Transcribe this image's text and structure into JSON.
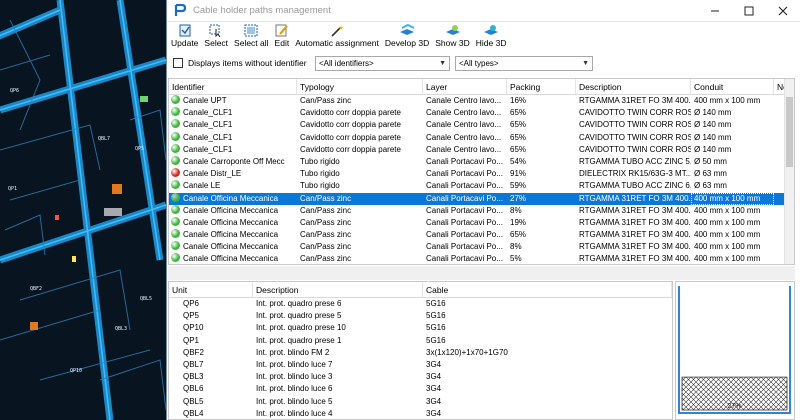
{
  "window": {
    "title": "Cable holder paths management",
    "minimize_icon": "minimize-icon",
    "maximize_icon": "maximize-icon",
    "close_icon": "close-icon"
  },
  "toolbar": {
    "items": [
      {
        "label": "Update",
        "icon": "update-icon"
      },
      {
        "label": "Select",
        "icon": "select-icon"
      },
      {
        "label": "Select all",
        "icon": "select-all-icon"
      },
      {
        "label": "Edit",
        "icon": "edit-icon"
      },
      {
        "label": "Automatic assignment",
        "icon": "magic-wand-icon"
      },
      {
        "label": "Develop 3D",
        "icon": "develop-3d-icon"
      },
      {
        "label": "Show 3D",
        "icon": "show-3d-icon"
      },
      {
        "label": "Hide 3D",
        "icon": "hide-3d-icon"
      }
    ]
  },
  "filters": {
    "checkbox_label": "Displays items without identifier",
    "checkbox_checked": false,
    "identifiers_value": "<All identifiers>",
    "types_value": "<All types>"
  },
  "top_grid": {
    "columns": [
      "Identifier",
      "Typology",
      "Layer",
      "Packing",
      "Description",
      "Conduit",
      "Not"
    ],
    "rows": [
      {
        "status": "green",
        "identifier": "Canale UPT",
        "typology": "Can/Pass zinc",
        "layer": "Canale Centro lavo...",
        "packing": "16%",
        "description": "RTGAMMA 31RET FO 3M 400...",
        "conduit": "400 mm x 100 mm",
        "selected": false
      },
      {
        "status": "green",
        "identifier": "Canale_CLF1",
        "typology": "Cavidotto corr doppia parete",
        "layer": "Canale Centro lavo...",
        "packing": "65%",
        "description": "CAVIDOTTO TWIN CORR ROSSO...",
        "conduit": "Ø 140 mm",
        "selected": false
      },
      {
        "status": "green",
        "identifier": "Canale_CLF1",
        "typology": "Cavidotto corr doppia parete",
        "layer": "Canale Centro lavo...",
        "packing": "65%",
        "description": "CAVIDOTTO TWIN CORR ROSSO...",
        "conduit": "Ø 140 mm",
        "selected": false
      },
      {
        "status": "green",
        "identifier": "Canale_CLF1",
        "typology": "Cavidotto corr doppia parete",
        "layer": "Canale Centro lavo...",
        "packing": "65%",
        "description": "CAVIDOTTO TWIN CORR ROSSO...",
        "conduit": "Ø 140 mm",
        "selected": false
      },
      {
        "status": "green",
        "identifier": "Canale_CLF1",
        "typology": "Cavidotto corr doppia parete",
        "layer": "Canale Centro lavo...",
        "packing": "65%",
        "description": "CAVIDOTTO TWIN CORR ROSSO...",
        "conduit": "Ø 140 mm",
        "selected": false
      },
      {
        "status": "green",
        "identifier": "Canale Carroponte Off Mecc",
        "typology": "Tubo rigido",
        "layer": "Canali Portacavi Po...",
        "packing": "54%",
        "description": "RTGAMMA TUBO ACC ZINC 5...",
        "conduit": "Ø 50 mm",
        "selected": false
      },
      {
        "status": "red",
        "identifier": "Canale Distr_LE",
        "typology": "Tubo rigido",
        "layer": "Canali Portacavi Po...",
        "packing": "91%",
        "description": "DIELECTRIX RK15/63G-3 MT...",
        "conduit": "Ø 63 mm",
        "selected": false
      },
      {
        "status": "green",
        "identifier": "Canale LE",
        "typology": "Tubo rigido",
        "layer": "Canali Portacavi Po...",
        "packing": "59%",
        "description": "RTGAMMA TUBO ACC ZINC 6...",
        "conduit": "Ø 63 mm",
        "selected": false
      },
      {
        "status": "green",
        "identifier": "Canale Officina Meccanica",
        "typology": "Can/Pass zinc",
        "layer": "Canali Portacavi Po...",
        "packing": "27%",
        "description": "RTGAMMA 31RET FO 3M 400...",
        "conduit": "400 mm x 100 mm",
        "selected": true
      },
      {
        "status": "green",
        "identifier": "Canale Officina Meccanica",
        "typology": "Can/Pass zinc",
        "layer": "Canali Portacavi Po...",
        "packing": "8%",
        "description": "RTGAMMA 31RET FO 3M 400...",
        "conduit": "400 mm x 100 mm",
        "selected": false
      },
      {
        "status": "green",
        "identifier": "Canale Officina Meccanica",
        "typology": "Can/Pass zinc",
        "layer": "Canali Portacavi Po...",
        "packing": "19%",
        "description": "RTGAMMA 31RET FO 3M 400...",
        "conduit": "400 mm x 100 mm",
        "selected": false
      },
      {
        "status": "green",
        "identifier": "Canale Officina Meccanica",
        "typology": "Can/Pass zinc",
        "layer": "Canali Portacavi Po...",
        "packing": "65%",
        "description": "RTGAMMA 31RET FO 3M 400...",
        "conduit": "400 mm x 100 mm",
        "selected": false
      },
      {
        "status": "green",
        "identifier": "Canale Officina Meccanica",
        "typology": "Can/Pass zinc",
        "layer": "Canali Portacavi Po...",
        "packing": "8%",
        "description": "RTGAMMA 31RET FO 3M 400...",
        "conduit": "400 mm x 100 mm",
        "selected": false
      },
      {
        "status": "green",
        "identifier": "Canale Officina Meccanica",
        "typology": "Can/Pass zinc",
        "layer": "Canali Portacavi Po...",
        "packing": "5%",
        "description": "RTGAMMA 31RET FO 3M 400...",
        "conduit": "400 mm x 100 mm",
        "selected": false
      }
    ]
  },
  "bottom_grid": {
    "columns": [
      "Unit",
      "Description",
      "Cable"
    ],
    "rows": [
      {
        "unit": "QP6",
        "description": "Int. prot. quadro prese 6",
        "cable": "5G16"
      },
      {
        "unit": "QP5",
        "description": "Int. prot. quadro prese 5",
        "cable": "5G16"
      },
      {
        "unit": "QP10",
        "description": "Int. prot. quadro prese 10",
        "cable": "5G16"
      },
      {
        "unit": "QP1",
        "description": "Int. prot. quadro prese 1",
        "cable": "5G16"
      },
      {
        "unit": "QBF2",
        "description": "Int. prot. blindo FM 2",
        "cable": "3x(1x120)+1x70+1G70"
      },
      {
        "unit": "QBL7",
        "description": "Int. prot. blindo luce 7",
        "cable": "3G4"
      },
      {
        "unit": "QBL3",
        "description": "Int. prot. blindo luce 3",
        "cable": "3G4"
      },
      {
        "unit": "QBL6",
        "description": "Int. prot. blindo luce 6",
        "cable": "3G4"
      },
      {
        "unit": "QBL5",
        "description": "Int. prot. blindo luce 5",
        "cable": "3G4"
      },
      {
        "unit": "QBL4",
        "description": "Int. prot. blindo luce 4",
        "cable": "3G4"
      }
    ]
  },
  "section_preview": {
    "fill_label": "27%",
    "fill_fraction": 0.27
  },
  "colors": {
    "selection": "#0a78d7",
    "status_green": "#3cb43c",
    "status_red": "#d8261f",
    "cad_background": "#08141f",
    "cad_lines": "#1c9de6"
  }
}
